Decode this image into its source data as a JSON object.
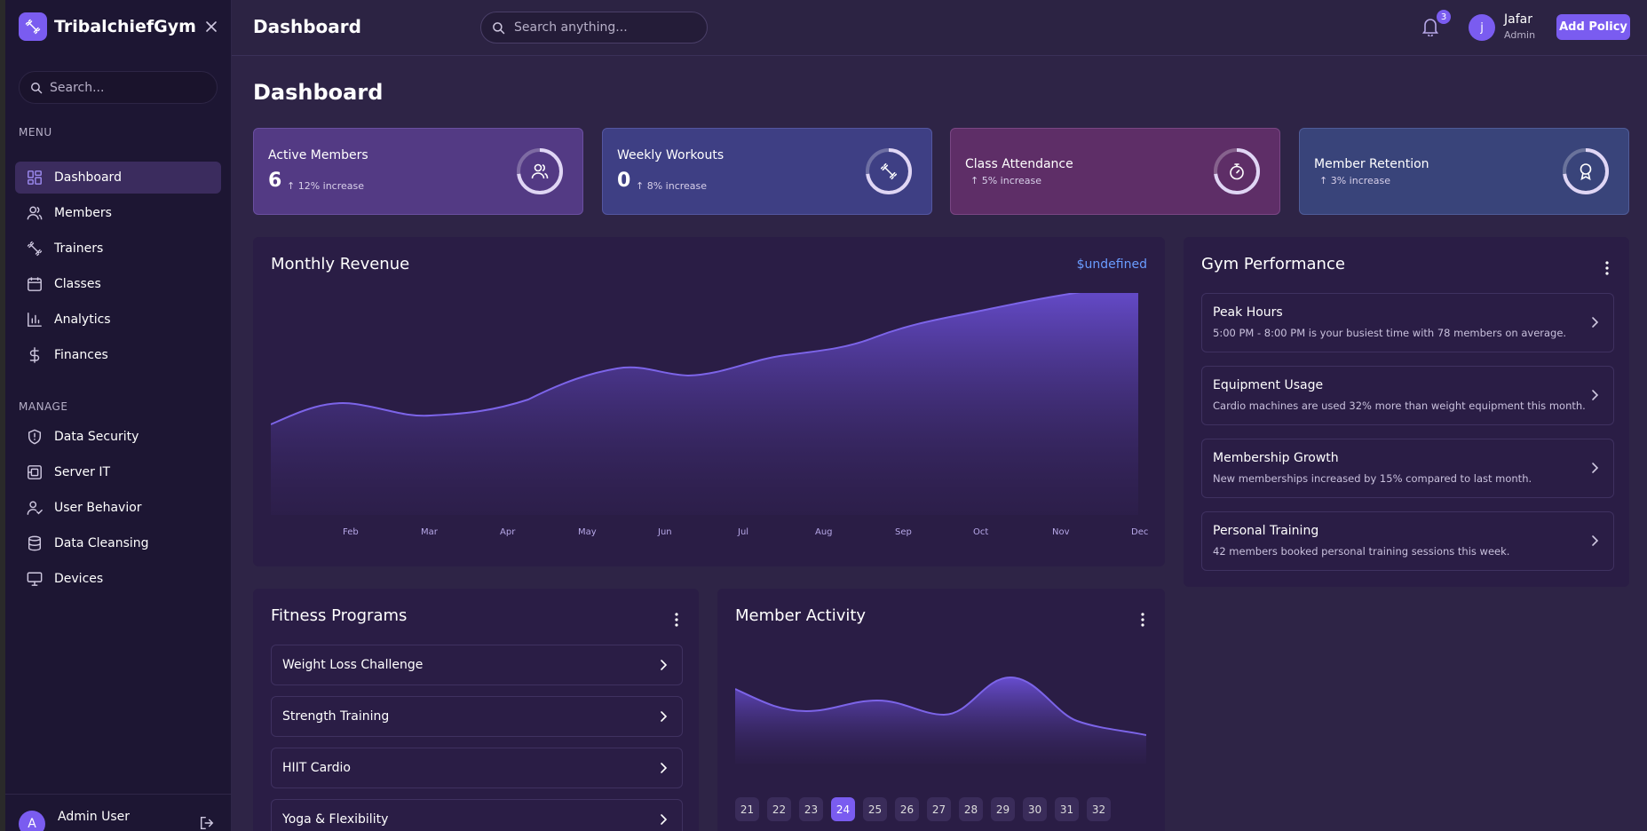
{
  "app": {
    "name": "TribalchiefGym"
  },
  "sidebar": {
    "search_placeholder": "Search...",
    "menu_label": "MENU",
    "manage_label": "MANAGE",
    "menu": [
      {
        "label": "Dashboard",
        "icon": "dashboard-icon"
      },
      {
        "label": "Members",
        "icon": "users-icon"
      },
      {
        "label": "Trainers",
        "icon": "dumbbell-icon"
      },
      {
        "label": "Classes",
        "icon": "calendar-icon"
      },
      {
        "label": "Analytics",
        "icon": "bar-chart-icon"
      },
      {
        "label": "Finances",
        "icon": "dollar-icon"
      }
    ],
    "manage": [
      {
        "label": "Data Security",
        "icon": "shield-icon"
      },
      {
        "label": "Server IT",
        "icon": "server-icon"
      },
      {
        "label": "User Behavior",
        "icon": "user-check-icon"
      },
      {
        "label": "Data Cleansing",
        "icon": "database-icon"
      },
      {
        "label": "Devices",
        "icon": "monitor-icon"
      }
    ],
    "footer": {
      "avatar": "A",
      "name": "Admin User"
    }
  },
  "topbar": {
    "title": "Dashboard",
    "search_placeholder": "Search anything...",
    "notifications": "3",
    "user": {
      "initial": "j",
      "name": "Jafar",
      "role": "Admin"
    },
    "add_policy": "Add Policy"
  },
  "page": {
    "title": "Dashboard"
  },
  "stats": [
    {
      "label": "Active Members",
      "value": "6",
      "trend": "↑ 12% increase",
      "color": "#533a84",
      "icon": "users-icon"
    },
    {
      "label": "Weekly Workouts",
      "value": "0",
      "trend": "↑ 8% increase",
      "color": "#3e3f84",
      "icon": "dumbbell-icon"
    },
    {
      "label": "Class Attendance",
      "value": "",
      "trend": "↑ 5% increase",
      "color": "#5e2e67",
      "icon": "stopwatch-icon"
    },
    {
      "label": "Member Retention",
      "value": "",
      "trend": "↑ 3% increase",
      "color": "#39447a",
      "icon": "award-icon"
    }
  ],
  "revenue": {
    "title": "Monthly Revenue",
    "total": "$undefined",
    "months": [
      "Feb",
      "Mar",
      "Apr",
      "May",
      "Jun",
      "Jul",
      "Aug",
      "Sep",
      "Oct",
      "Nov",
      "Dec"
    ]
  },
  "performance": {
    "title": "Gym Performance",
    "items": [
      {
        "title": "Peak Hours",
        "desc": "5:00 PM - 8:00 PM is your busiest time with 78 members on average."
      },
      {
        "title": "Equipment Usage",
        "desc": "Cardio machines are used 32% more than weight equipment this month."
      },
      {
        "title": "Membership Growth",
        "desc": "New memberships increased by 15% compared to last month."
      },
      {
        "title": "Personal Training",
        "desc": "42 members booked personal training sessions this week."
      }
    ]
  },
  "programs": {
    "title": "Fitness Programs",
    "items": [
      "Weight Loss Challenge",
      "Strength Training",
      "HIIT Cardio",
      "Yoga & Flexibility"
    ]
  },
  "activity": {
    "title": "Member Activity",
    "days": [
      "21",
      "22",
      "23",
      "24",
      "25",
      "26",
      "27",
      "28",
      "29",
      "30",
      "31",
      "32"
    ],
    "selected": "24"
  },
  "colors": {
    "accent": "#7a5cf0",
    "background": "#2e2446",
    "sidebar": "#1d1633",
    "panel": "#2a1d45"
  }
}
